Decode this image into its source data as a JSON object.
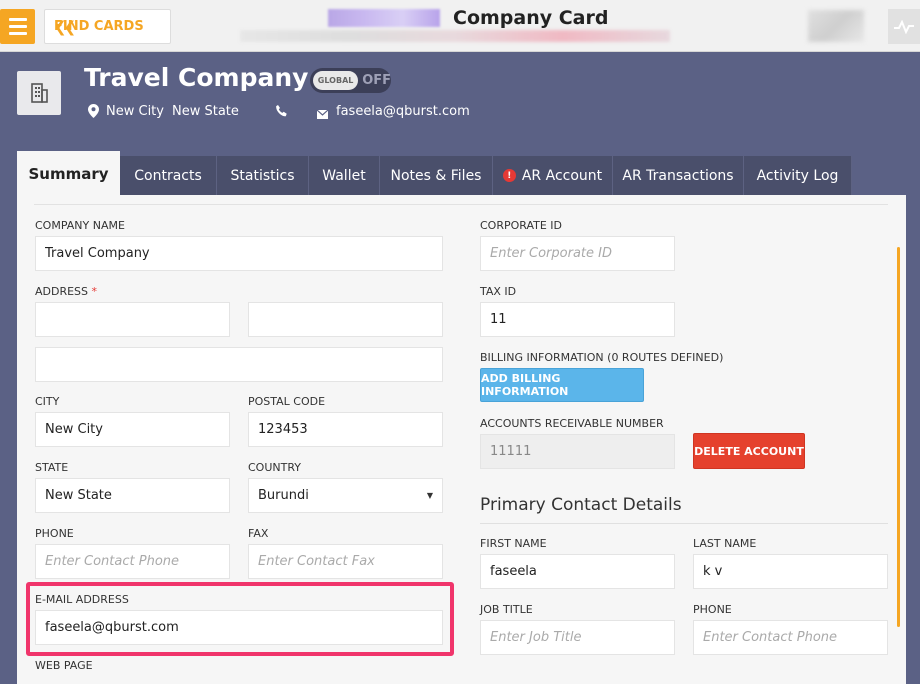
{
  "topbar": {
    "find_cards_label": "FIND CARDS",
    "title": "Company Card"
  },
  "company": {
    "name": "Travel Company",
    "toggle_knob": "GLOBAL",
    "toggle_state": "OFF",
    "city": "New City",
    "state": "New State",
    "email": "faseela@qburst.com"
  },
  "tabs": [
    "Summary",
    "Contracts",
    "Statistics",
    "Wallet",
    "Notes & Files",
    "AR Account",
    "AR Transactions",
    "Activity Log"
  ],
  "form": {
    "company_name_label": "COMPANY NAME",
    "company_name": "Travel Company",
    "address_label": "ADDRESS",
    "address_required": "*",
    "city_label": "CITY",
    "city": "New City",
    "postal_label": "POSTAL CODE",
    "postal": "123453",
    "state_label": "STATE",
    "state": "New State",
    "country_label": "COUNTRY",
    "country": "Burundi",
    "phone_label": "PHONE",
    "phone_placeholder": "Enter Contact Phone",
    "fax_label": "FAX",
    "fax_placeholder": "Enter Contact Fax",
    "email_label": "E-MAIL ADDRESS",
    "email": "faseela@qburst.com",
    "webpage_label": "WEB PAGE"
  },
  "right": {
    "corporate_id_label": "CORPORATE ID",
    "corporate_id_placeholder": "Enter Corporate ID",
    "tax_id_label": "TAX ID",
    "tax_id": "11",
    "billing_label": "BILLING INFORMATION (0 ROUTES DEFINED)",
    "billing_button": "ADD BILLING INFORMATION",
    "ar_number_label": "ACCOUNTS RECEIVABLE NUMBER",
    "ar_number": "11111",
    "delete_button": "DELETE ACCOUNT",
    "contact_title": "Primary Contact Details",
    "first_name_label": "FIRST NAME",
    "first_name": "faseela",
    "last_name_label": "LAST NAME",
    "last_name": "k v",
    "job_title_label": "JOB TITLE",
    "job_title_placeholder": "Enter Job Title",
    "contact_phone_label": "PHONE",
    "contact_phone_placeholder": "Enter Contact Phone"
  },
  "colors": {
    "background": "#5b6185",
    "accent": "#f5a623",
    "highlight": "#f0356b",
    "button_blue": "#5bb5ea",
    "button_red": "#e5412d"
  }
}
